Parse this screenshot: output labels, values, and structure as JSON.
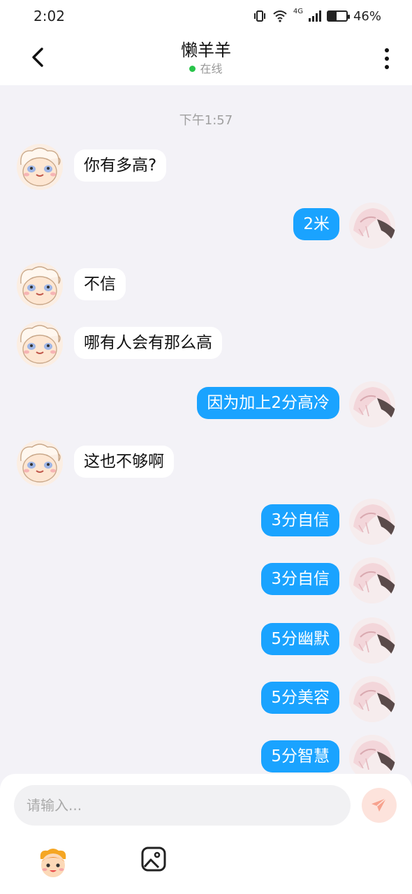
{
  "status_bar": {
    "time": "2:02",
    "network": "4G",
    "battery": "46%",
    "battery_level": 0.46
  },
  "header": {
    "title": "懒羊羊",
    "status": "在线"
  },
  "chat": {
    "timestamp": "下午1:57",
    "messages": [
      {
        "side": "left",
        "text": "你有多高?"
      },
      {
        "side": "right",
        "text": "2米"
      },
      {
        "side": "left",
        "text": "不信"
      },
      {
        "side": "left",
        "text": "哪有人会有那么高"
      },
      {
        "side": "right",
        "text": "因为加上2分高冷"
      },
      {
        "side": "left",
        "text": "这也不够啊"
      },
      {
        "side": "right",
        "text": "3分自信"
      },
      {
        "side": "right",
        "text": "3分自信"
      },
      {
        "side": "right",
        "text": "5分幽默"
      },
      {
        "side": "right",
        "text": "5分美容"
      },
      {
        "side": "right",
        "text": "5分智慧"
      }
    ]
  },
  "input": {
    "placeholder": "请输入..."
  },
  "colors": {
    "accent": "#1aa3ff",
    "online": "#28c44a",
    "send": "#fde3dc",
    "background": "#f3f2f7"
  },
  "icons": [
    "back-arrow-icon",
    "more-icon",
    "send-icon",
    "emoji-sticker-icon",
    "image-icon"
  ]
}
